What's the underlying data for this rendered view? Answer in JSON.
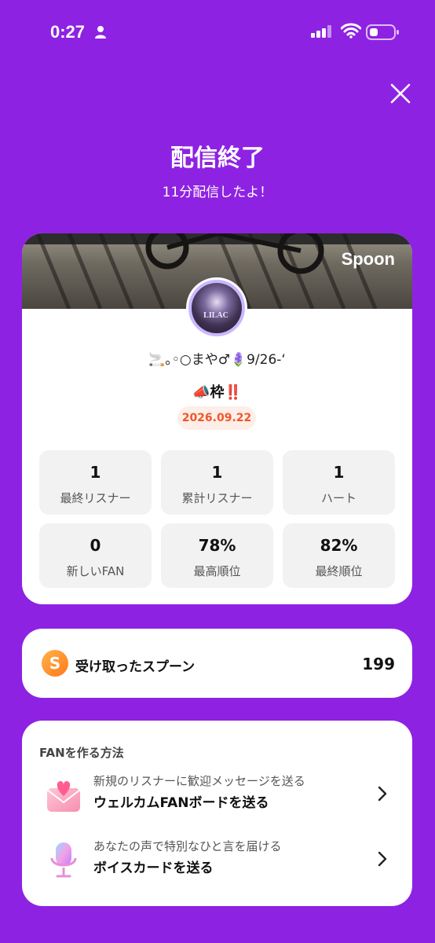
{
  "status_bar": {
    "time": "0:27"
  },
  "header": {
    "title": "配信終了",
    "subtitle": "11分配信したよ！"
  },
  "summary": {
    "brand": "Spoon",
    "avatar_text": "LILAC",
    "username": "🚬｡◦○まや♂🪻9/26-‘",
    "live_title": "📣枠‼️",
    "date": "2026.09.22",
    "stats": [
      {
        "value": "1",
        "label": "最終リスナー"
      },
      {
        "value": "1",
        "label": "累計リスナー"
      },
      {
        "value": "1",
        "label": "ハート"
      },
      {
        "value": "0",
        "label": "新しいFAN"
      },
      {
        "value": "78%",
        "label": "最高順位"
      },
      {
        "value": "82%",
        "label": "最終順位"
      }
    ]
  },
  "spoons": {
    "icon_letter": "S",
    "label": "受け取ったスプーン",
    "count": "199"
  },
  "fan_tips": {
    "heading": "FANを作る方法",
    "items": [
      {
        "icon": "love-letter-icon",
        "sub": "新規のリスナーに歓迎メッセージを送る",
        "main": "ウェルカムFANボードを送る"
      },
      {
        "icon": "microphone-icon",
        "sub": "あなたの声で特別なひと言を届ける",
        "main": "ボイスカードを送る"
      }
    ]
  },
  "colors": {
    "background": "#8e22e2",
    "accent_orange": "#f0562a",
    "card": "#ffffff"
  }
}
